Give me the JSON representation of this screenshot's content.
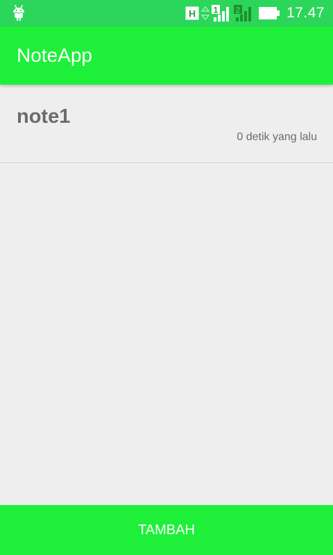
{
  "status_bar": {
    "network_type": "H",
    "sim1_label": "1",
    "sim2_label": "2",
    "time": "17.47",
    "icons": [
      "android-debug-icon",
      "hsdpa-icon",
      "data-arrows-icon",
      "sim1-signal-icon",
      "sim2-signal-icon",
      "battery-icon"
    ]
  },
  "app_bar": {
    "title": "NoteApp"
  },
  "notes": [
    {
      "title": "note1",
      "time": "0 detik yang lalu"
    }
  ],
  "footer": {
    "add_label": "TAMBAH"
  },
  "colors": {
    "status_bar": "#2cd65a",
    "primary": "#1ef03a",
    "background": "#eeeeee",
    "note_text": "#6b6b6b",
    "divider": "#d3d3d3",
    "on_primary": "#ffffff"
  }
}
